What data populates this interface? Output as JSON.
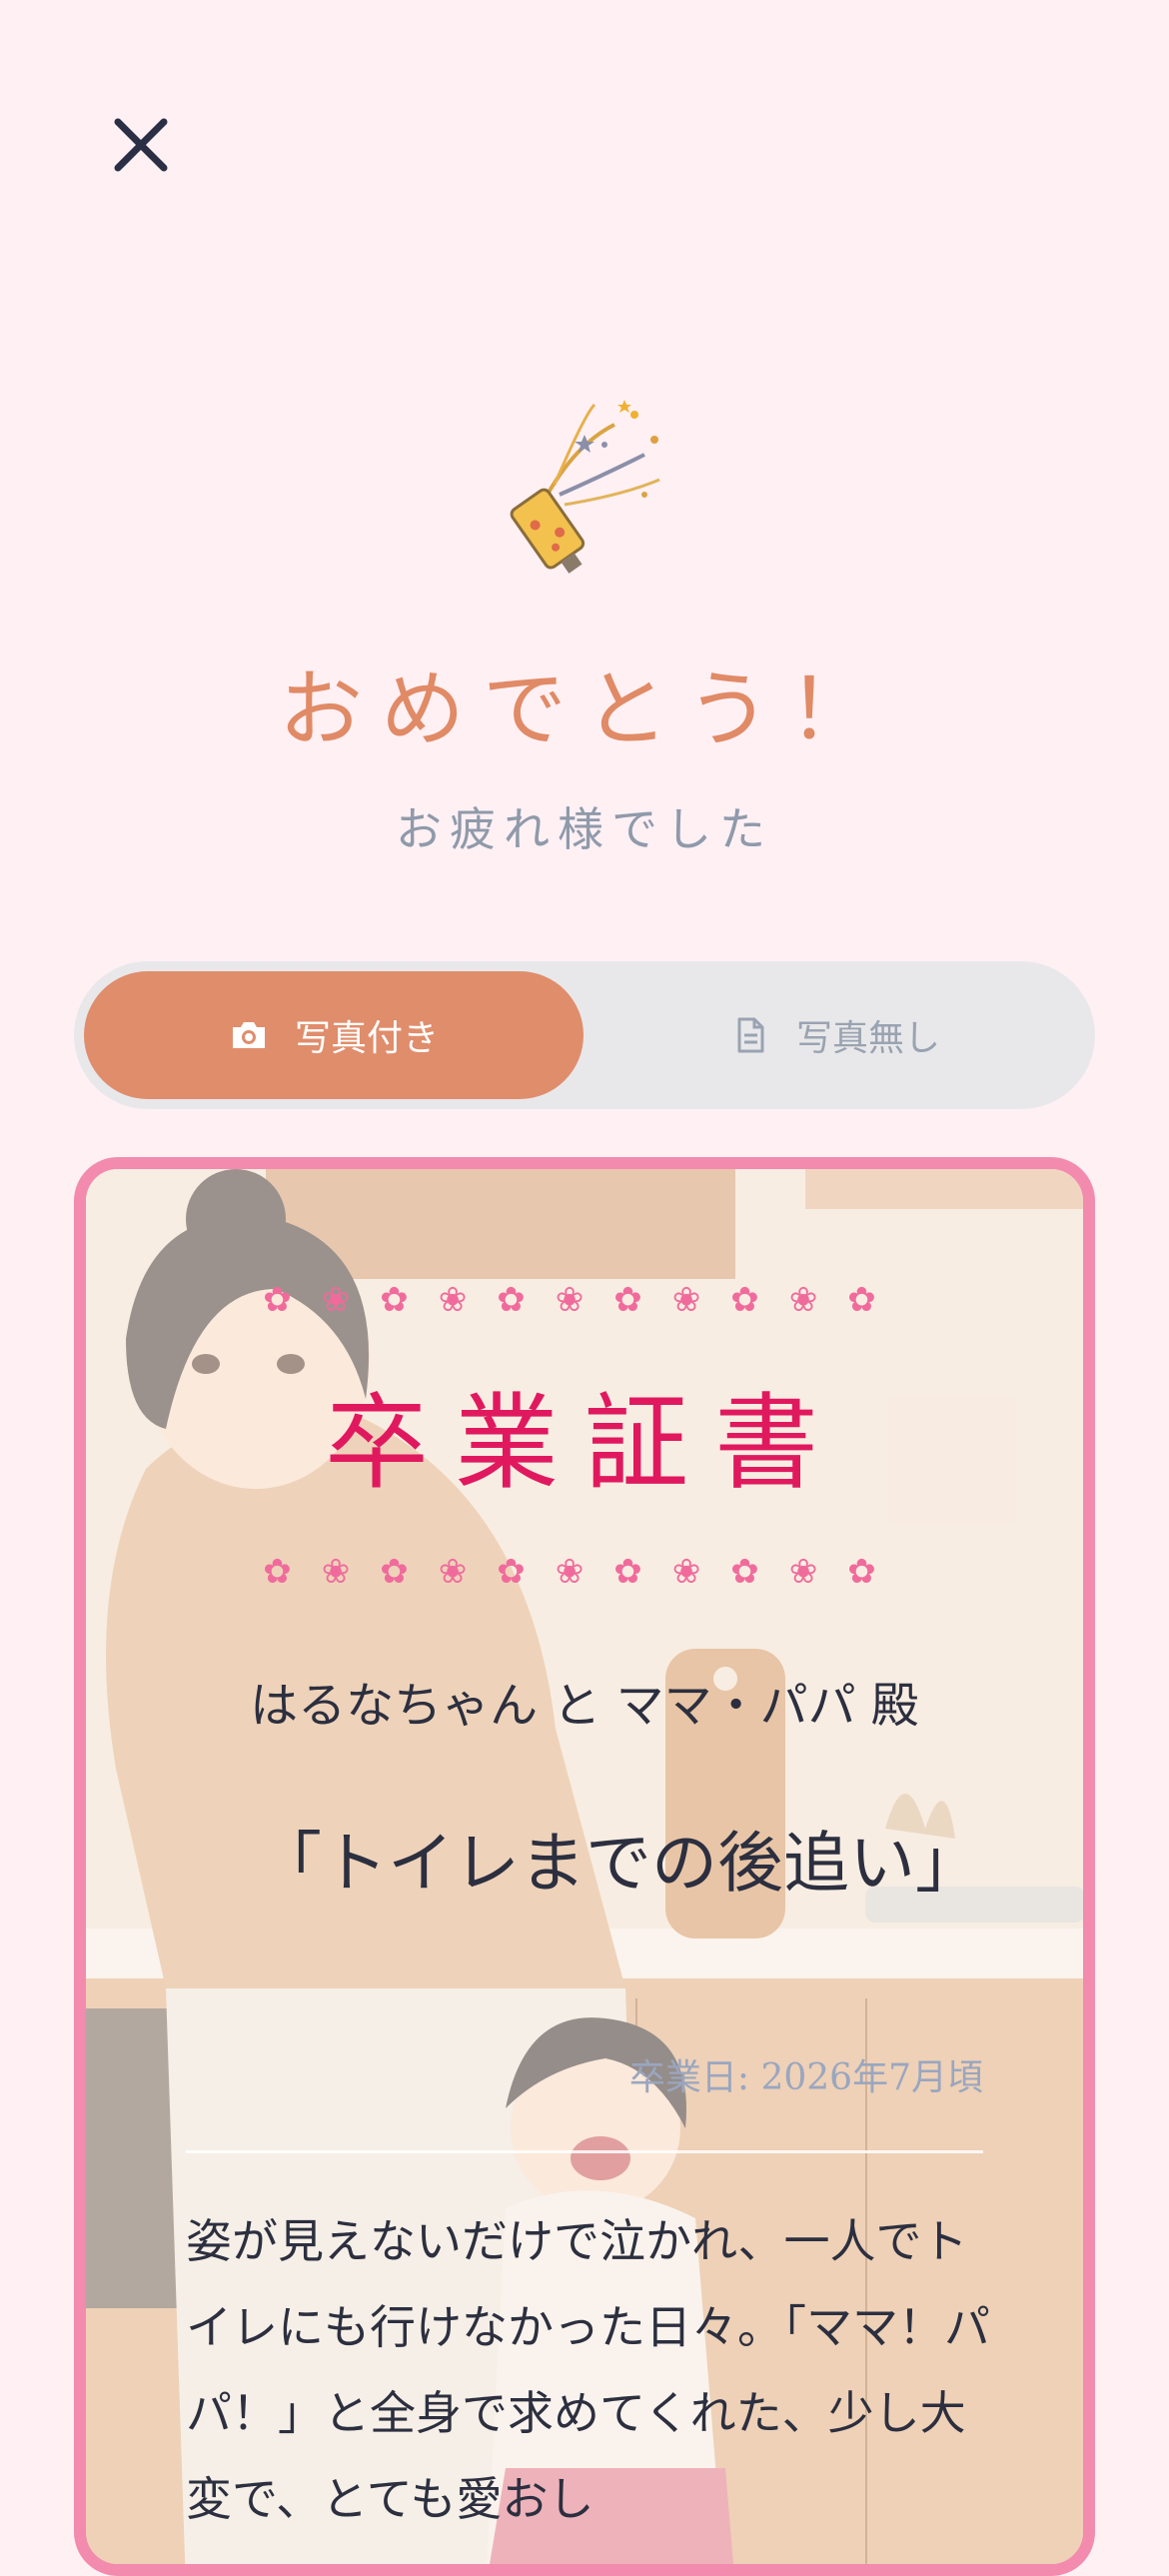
{
  "header": {
    "close_icon": "close-icon"
  },
  "celebration": {
    "icon": "party-popper-icon",
    "title": "おめでとう！",
    "subtitle": "お疲れ様でした"
  },
  "toggle": {
    "with_photo": {
      "label": "写真付き",
      "icon": "camera-icon",
      "selected": true
    },
    "without_photo": {
      "label": "写真無し",
      "icon": "document-icon",
      "selected": false
    }
  },
  "certificate": {
    "flower_icon": "flower-icon",
    "title": "卒業証書",
    "recipient": "はるなちゃん と ママ・パパ 殿",
    "name": "「トイレまでの後追い」",
    "date": "卒業日: 2026年7月頃",
    "message": "姿が見えないだけで泣かれ、一人でトイレにも行けなかった日々。「ママ！パパ！」と全身で求めてくれた、少し大変で、とても愛おし",
    "colors": {
      "border": "#f28bae",
      "title": "#e0195f",
      "flowers": "#f06b9c"
    }
  },
  "colors": {
    "background": "#fff0f4",
    "accent": "#e08d6c"
  }
}
